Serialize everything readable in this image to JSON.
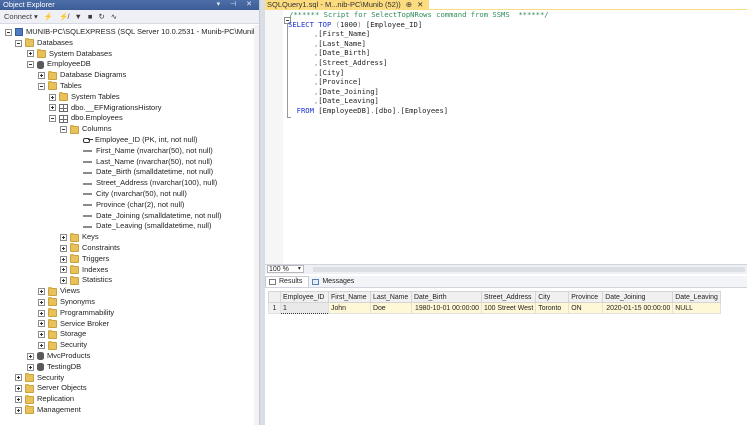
{
  "object_explorer": {
    "title": "Object Explorer",
    "title_buttons": "▾ ⊣ ✕",
    "toolbar": {
      "connect_label": "Connect ▾",
      "icons": [
        "connect-icon",
        "disconnect-icon",
        "filter-icon",
        "stop-icon",
        "refresh-icon",
        "activity-icon"
      ]
    },
    "tree": [
      {
        "label": "MUNIB-PC\\SQLEXPRESS (SQL Server 10.0.2531 - Munib-PC\\Munib)",
        "icon": "server",
        "exp": "minus",
        "indent": 0
      },
      {
        "label": "Databases",
        "icon": "folder",
        "exp": "minus",
        "indent": 1
      },
      {
        "label": "System Databases",
        "icon": "folder",
        "exp": "plus",
        "indent": 2
      },
      {
        "label": "EmployeeDB",
        "icon": "db",
        "exp": "minus",
        "indent": 2
      },
      {
        "label": "Database Diagrams",
        "icon": "folder",
        "exp": "plus",
        "indent": 3
      },
      {
        "label": "Tables",
        "icon": "folder",
        "exp": "minus",
        "indent": 3
      },
      {
        "label": "System Tables",
        "icon": "folder",
        "exp": "plus",
        "indent": 4
      },
      {
        "label": "dbo.__EFMigrationsHistory",
        "icon": "table",
        "exp": "plus",
        "indent": 4
      },
      {
        "label": "dbo.Employees",
        "icon": "table",
        "exp": "minus",
        "indent": 4
      },
      {
        "label": "Columns",
        "icon": "folder",
        "exp": "minus",
        "indent": 5
      },
      {
        "label": "Employee_ID (PK, int, not null)",
        "icon": "key",
        "exp": "none",
        "indent": 6
      },
      {
        "label": "First_Name (nvarchar(50), not null)",
        "icon": "col",
        "exp": "none",
        "indent": 6
      },
      {
        "label": "Last_Name (nvarchar(50), not null)",
        "icon": "col",
        "exp": "none",
        "indent": 6
      },
      {
        "label": "Date_Birth (smalldatetime, not null)",
        "icon": "col",
        "exp": "none",
        "indent": 6
      },
      {
        "label": "Street_Address (nvarchar(100), null)",
        "icon": "col",
        "exp": "none",
        "indent": 6
      },
      {
        "label": "City (nvarchar(50), not null)",
        "icon": "col",
        "exp": "none",
        "indent": 6
      },
      {
        "label": "Province (char(2), not null)",
        "icon": "col",
        "exp": "none",
        "indent": 6
      },
      {
        "label": "Date_Joining (smalldatetime, not null)",
        "icon": "col",
        "exp": "none",
        "indent": 6
      },
      {
        "label": "Date_Leaving (smalldatetime, null)",
        "icon": "col",
        "exp": "none",
        "indent": 6
      },
      {
        "label": "Keys",
        "icon": "folder",
        "exp": "plus",
        "indent": 5
      },
      {
        "label": "Constraints",
        "icon": "folder",
        "exp": "plus",
        "indent": 5
      },
      {
        "label": "Triggers",
        "icon": "folder",
        "exp": "plus",
        "indent": 5
      },
      {
        "label": "Indexes",
        "icon": "folder",
        "exp": "plus",
        "indent": 5
      },
      {
        "label": "Statistics",
        "icon": "folder",
        "exp": "plus",
        "indent": 5
      },
      {
        "label": "Views",
        "icon": "folder",
        "exp": "plus",
        "indent": 3
      },
      {
        "label": "Synonyms",
        "icon": "folder",
        "exp": "plus",
        "indent": 3
      },
      {
        "label": "Programmability",
        "icon": "folder",
        "exp": "plus",
        "indent": 3
      },
      {
        "label": "Service Broker",
        "icon": "folder",
        "exp": "plus",
        "indent": 3
      },
      {
        "label": "Storage",
        "icon": "folder",
        "exp": "plus",
        "indent": 3
      },
      {
        "label": "Security",
        "icon": "folder",
        "exp": "plus",
        "indent": 3
      },
      {
        "label": "MvcProducts",
        "icon": "db",
        "exp": "plus",
        "indent": 2
      },
      {
        "label": "TestingDB",
        "icon": "db",
        "exp": "plus",
        "indent": 2
      },
      {
        "label": "Security",
        "icon": "folder",
        "exp": "plus",
        "indent": 1
      },
      {
        "label": "Server Objects",
        "icon": "folder",
        "exp": "plus",
        "indent": 1
      },
      {
        "label": "Replication",
        "icon": "folder",
        "exp": "plus",
        "indent": 1
      },
      {
        "label": "Management",
        "icon": "folder",
        "exp": "plus",
        "indent": 1
      }
    ]
  },
  "query_tab": {
    "title": "SQLQuery1.sql - M...nib-PC\\Munib (52))",
    "pin": "⊕",
    "close": "✕"
  },
  "editor": {
    "lines": [
      [
        {
          "t": "/****** Script for SelectTopNRows command from SSMS  ******/",
          "c": "cm"
        }
      ],
      [
        {
          "t": "SELECT TOP ",
          "c": "kw"
        },
        {
          "t": "(",
          "c": "gr"
        },
        {
          "t": "1000",
          "c": "tx"
        },
        {
          "t": ")",
          "c": "gr"
        },
        {
          "t": " [Employee_ID]",
          "c": "tx"
        }
      ],
      [
        {
          "t": "      ,",
          "c": "gr"
        },
        {
          "t": "[First_Name]",
          "c": "tx"
        }
      ],
      [
        {
          "t": "      ,",
          "c": "gr"
        },
        {
          "t": "[Last_Name]",
          "c": "tx"
        }
      ],
      [
        {
          "t": "      ,",
          "c": "gr"
        },
        {
          "t": "[Date_Birth]",
          "c": "tx"
        }
      ],
      [
        {
          "t": "      ,",
          "c": "gr"
        },
        {
          "t": "[Street_Address]",
          "c": "tx"
        }
      ],
      [
        {
          "t": "      ,",
          "c": "gr"
        },
        {
          "t": "[City]",
          "c": "tx"
        }
      ],
      [
        {
          "t": "      ,",
          "c": "gr"
        },
        {
          "t": "[Province]",
          "c": "tx"
        }
      ],
      [
        {
          "t": "      ,",
          "c": "gr"
        },
        {
          "t": "[Date_Joining]",
          "c": "tx"
        }
      ],
      [
        {
          "t": "      ,",
          "c": "gr"
        },
        {
          "t": "[Date_Leaving]",
          "c": "tx"
        }
      ],
      [
        {
          "t": "  FROM ",
          "c": "kw"
        },
        {
          "t": "[EmployeeDB]",
          "c": "tx"
        },
        {
          "t": ".",
          "c": "gr"
        },
        {
          "t": "[dbo]",
          "c": "tx"
        },
        {
          "t": ".",
          "c": "gr"
        },
        {
          "t": "[Employees]",
          "c": "tx"
        }
      ]
    ]
  },
  "zoom": {
    "value": "100 %"
  },
  "result_tabs": [
    {
      "label": "Results",
      "icon": "grid-icon",
      "active": true
    },
    {
      "label": "Messages",
      "icon": "messages-icon",
      "active": false
    }
  ],
  "results": {
    "columns": [
      "Employee_ID",
      "First_Name",
      "Last_Name",
      "Date_Birth",
      "Street_Address",
      "City",
      "Province",
      "Date_Joining",
      "Date_Leaving"
    ],
    "rows": [
      {
        "rownum": "1",
        "cells": [
          "1",
          "John",
          "Doe",
          "1980-10-01 00:00:00",
          "100 Street West",
          "Toronto",
          "ON",
          "2020-01-15 00:00:00",
          "NULL"
        ]
      }
    ]
  }
}
